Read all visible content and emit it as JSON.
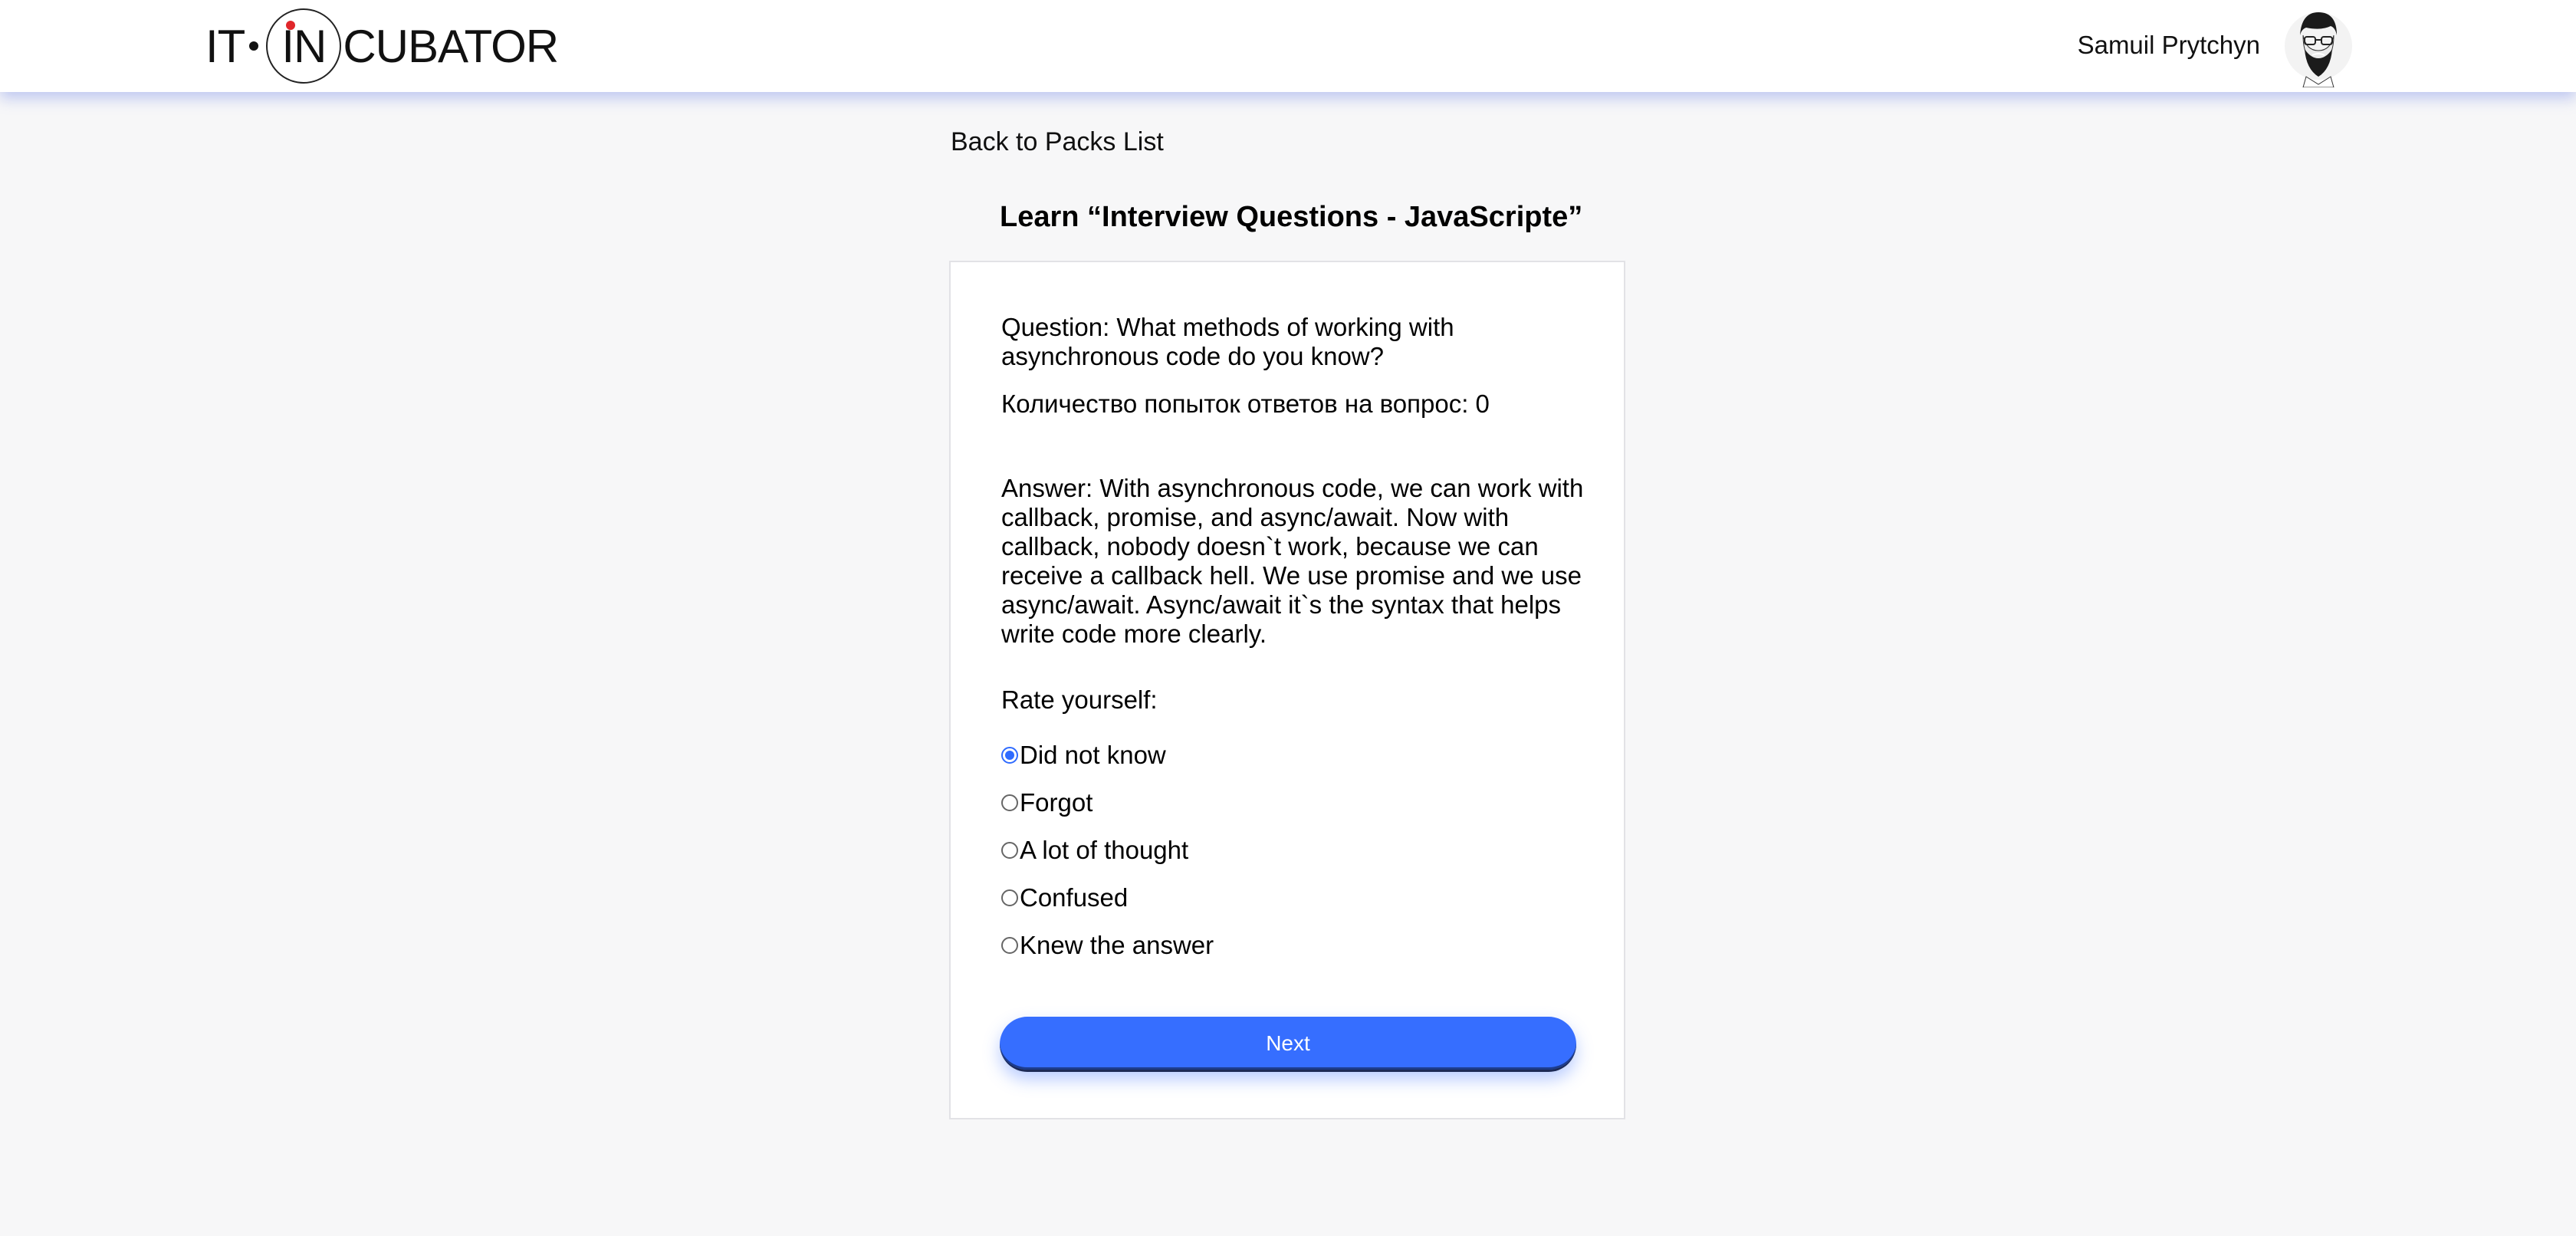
{
  "header": {
    "logo_left": "IT",
    "logo_mid": "IN",
    "logo_right": "CUBATOR",
    "user_name": "Samuil Prytchyn"
  },
  "nav": {
    "back_label": "Back to Packs List"
  },
  "page": {
    "title": "Learn “Interview Questions - JavaScripte”"
  },
  "card": {
    "question": "Question: What methods of working with asynchronous code do you know?",
    "attempts": "Количество попыток ответов на вопрос: 0",
    "answer": "Answer: With asynchronous code, we can work with callback, promise, and async/await. Now with callback, nobody doesn`t work, because we can receive a callback hell. We use promise and we use async/await. Async/await it`s the syntax that helps write code more clearly.",
    "rate_label": "Rate yourself:",
    "options": [
      {
        "label": "Did not know",
        "checked": true
      },
      {
        "label": "Forgot",
        "checked": false
      },
      {
        "label": "A lot of thought",
        "checked": false
      },
      {
        "label": "Confused",
        "checked": false
      },
      {
        "label": "Knew the answer",
        "checked": false
      }
    ],
    "next_label": "Next"
  },
  "colors": {
    "accent": "#366eff",
    "background": "#f7f7f8",
    "logo_dot": "#e0262a"
  },
  "icons": {
    "avatar": "bearded-man-avatar-icon"
  }
}
